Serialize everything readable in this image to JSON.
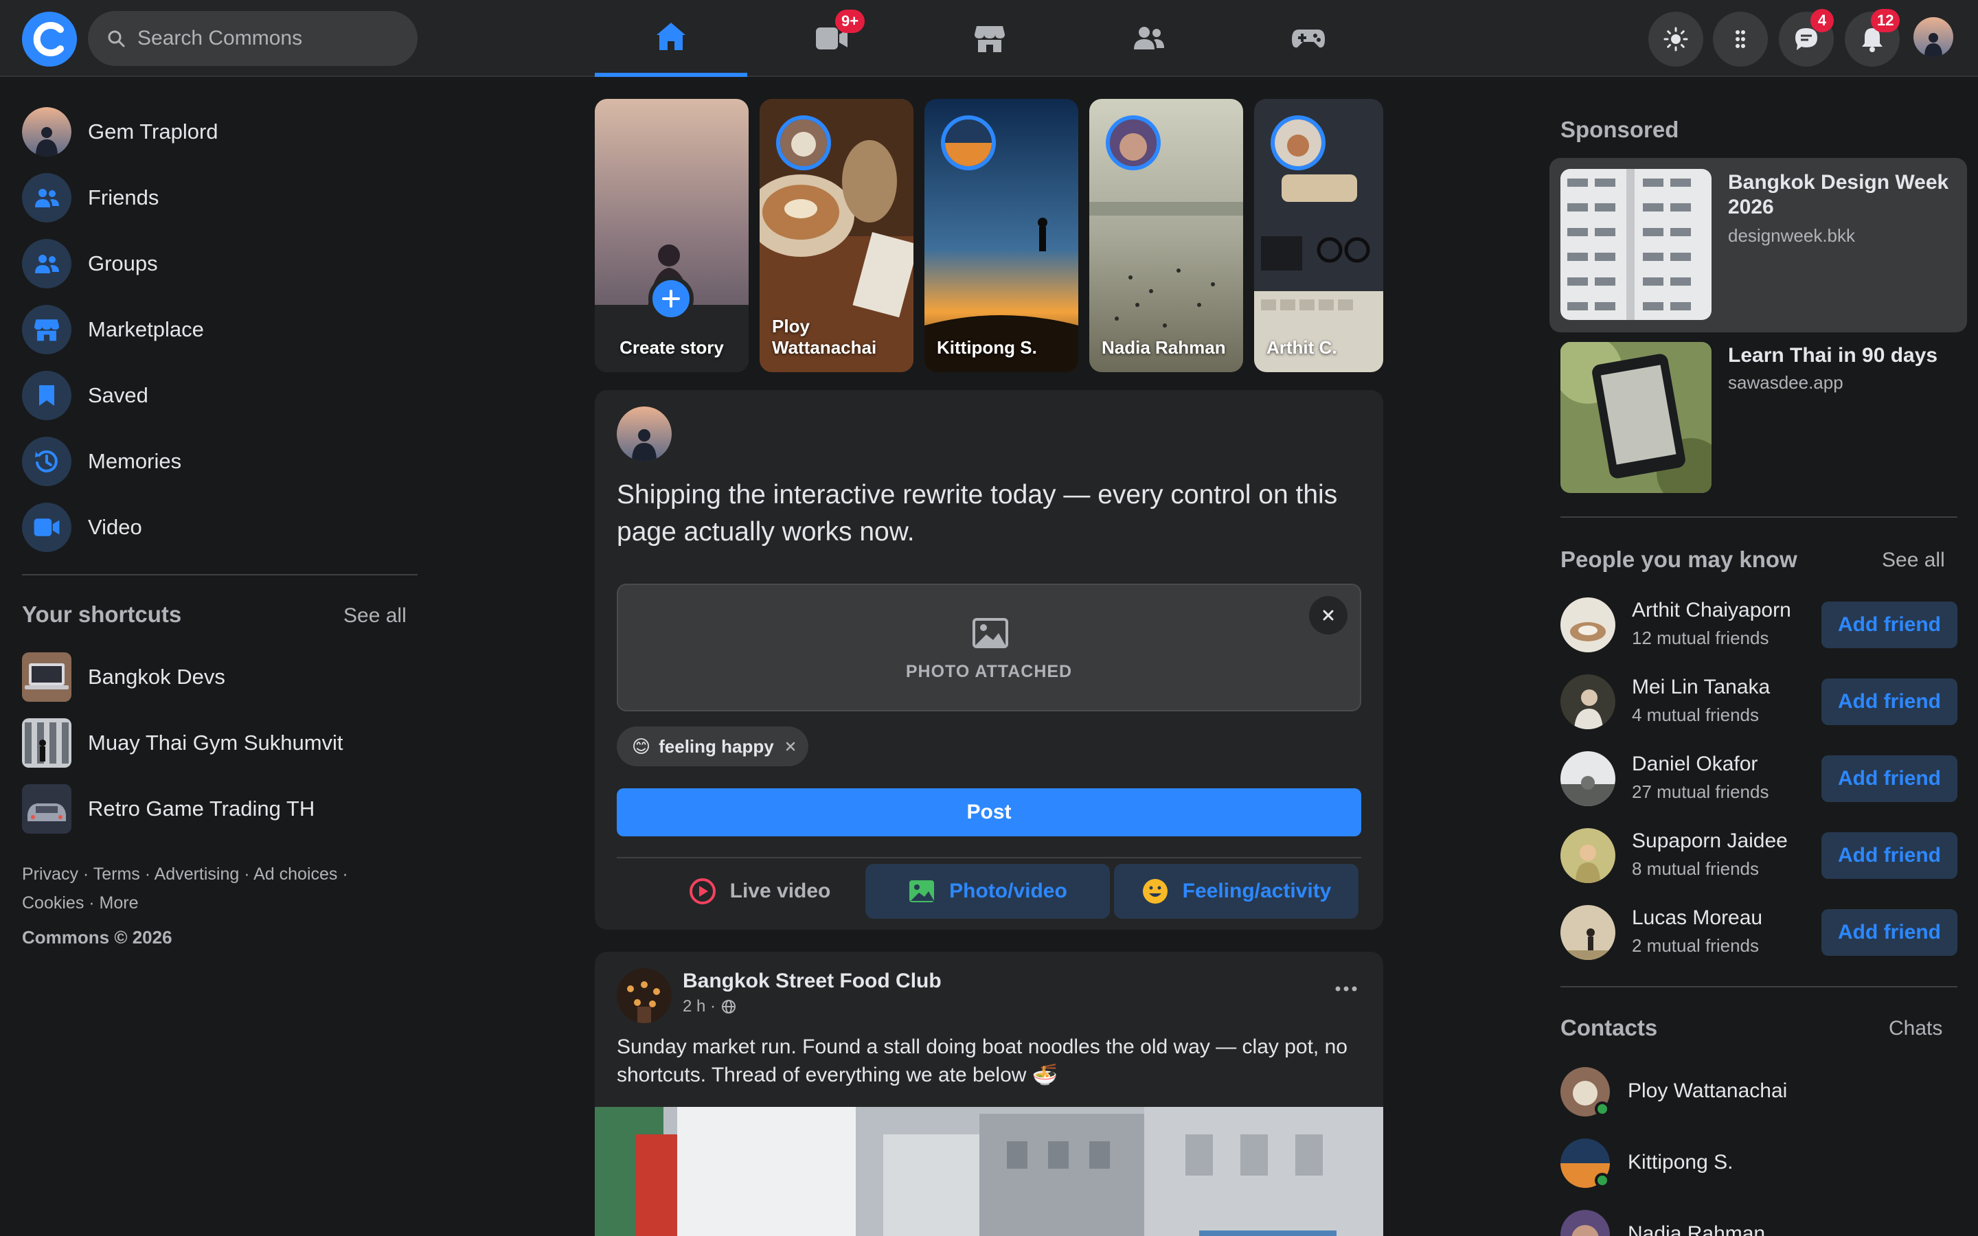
{
  "app": {
    "name": "Commons",
    "logo_letter": "C"
  },
  "search": {
    "placeholder": "Search Commons"
  },
  "nav": {
    "tabs": [
      {
        "name": "home",
        "active": true,
        "badge": ""
      },
      {
        "name": "video",
        "active": false,
        "badge": "9+"
      },
      {
        "name": "marketplace",
        "active": false,
        "badge": ""
      },
      {
        "name": "groups",
        "active": false,
        "badge": ""
      },
      {
        "name": "gaming",
        "active": false,
        "badge": ""
      }
    ],
    "messenger_badge": "4",
    "notifications_badge": "12"
  },
  "sidebar": {
    "user": "Gem Traplord",
    "items": [
      {
        "label": "Friends",
        "icon": "friends-icon"
      },
      {
        "label": "Groups",
        "icon": "groups-icon"
      },
      {
        "label": "Marketplace",
        "icon": "marketplace-icon"
      },
      {
        "label": "Saved",
        "icon": "bookmark-icon"
      },
      {
        "label": "Memories",
        "icon": "memories-icon"
      },
      {
        "label": "Video",
        "icon": "video-icon"
      }
    ],
    "shortcuts_title": "Your shortcuts",
    "shortcuts_see_all": "See all",
    "shortcuts": [
      "Bangkok Devs",
      "Muay Thai Gym Sukhumvit",
      "Retro Game Trading TH"
    ],
    "footer_line1": "Privacy · Terms · Advertising · Ad choices ·",
    "footer_line2": "Cookies · More",
    "copyright": "Commons © 2026"
  },
  "stories": {
    "create_label": "Create story",
    "items": [
      {
        "name": "Ploy Wattanachai"
      },
      {
        "name": "Kittipong S."
      },
      {
        "name": "Nadia Rahman"
      },
      {
        "name": "Arthit C."
      }
    ]
  },
  "composer": {
    "text": "Shipping the interactive rewrite today — every control on this page actually works now.",
    "photo_label": "PHOTO ATTACHED",
    "feeling_emoji": "😊",
    "feeling_label": "feeling happy",
    "post_label": "Post",
    "actions": {
      "live": "Live video",
      "photo": "Photo/video",
      "feeling": "Feeling/activity"
    }
  },
  "feed_post": {
    "author": "Bangkok Street Food Club",
    "time": "2 h ·",
    "body": "Sunday market run. Found a stall doing boat noodles the old way — clay pot, no shortcuts. Thread of everything we ate below 🍜"
  },
  "sponsored": {
    "title": "Sponsored",
    "ads": [
      {
        "title": "Bangkok Design Week 2026",
        "domain": "designweek.bkk"
      },
      {
        "title": "Learn Thai in 90 days",
        "domain": "sawasdee.app"
      }
    ]
  },
  "people": {
    "title": "People you may know",
    "see_all": "See all",
    "add_label": "Add friend",
    "items": [
      {
        "name": "Arthit Chaiyaporn",
        "mutual": "12 mutual friends"
      },
      {
        "name": "Mei Lin Tanaka",
        "mutual": "4 mutual friends"
      },
      {
        "name": "Daniel Okafor",
        "mutual": "27 mutual friends"
      },
      {
        "name": "Supaporn Jaidee",
        "mutual": "8 mutual friends"
      },
      {
        "name": "Lucas Moreau",
        "mutual": "2 mutual friends"
      }
    ]
  },
  "contacts": {
    "title": "Contacts",
    "chats": "Chats",
    "items": [
      "Ploy Wattanachai",
      "Kittipong S.",
      "Nadia Rahman"
    ]
  },
  "colors": {
    "accent": "#2d88ff",
    "background": "#18191a",
    "surface": "#242526",
    "badge": "#e41e3f",
    "online": "#31a24c"
  }
}
